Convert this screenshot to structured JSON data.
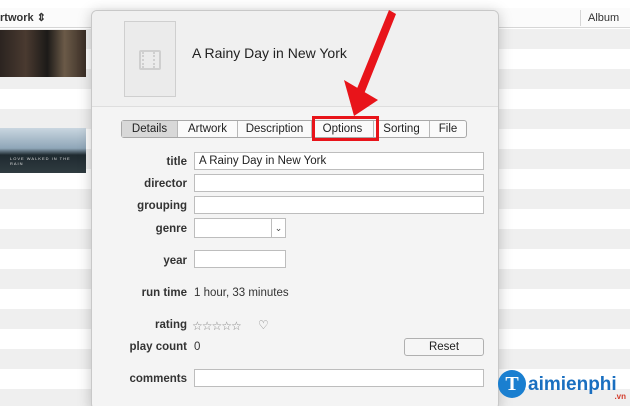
{
  "background_list": {
    "artwork_header": "rtwork",
    "sort_icon": "sort-updown-icon",
    "album_header": "Album",
    "thumb2_caption": "LOVE WALKED IN THE RAIN"
  },
  "dialog": {
    "title": "A Rainy Day in New York",
    "artwork_icon": "film-placeholder-icon",
    "tabs": [
      {
        "label": "Details",
        "active": true
      },
      {
        "label": "Artwork",
        "active": false
      },
      {
        "label": "Description",
        "active": false
      },
      {
        "label": "Options",
        "active": false
      },
      {
        "label": "Sorting",
        "active": false
      },
      {
        "label": "File",
        "active": false
      }
    ],
    "fields": {
      "title_label": "title",
      "title_value": "A Rainy Day in New York",
      "director_label": "director",
      "director_value": "",
      "grouping_label": "grouping",
      "grouping_value": "",
      "genre_label": "genre",
      "genre_value": "",
      "year_label": "year",
      "year_value": "",
      "run_time_label": "run time",
      "run_time_value": "1 hour, 33 minutes",
      "rating_label": "rating",
      "rating_stars": "☆☆☆☆☆",
      "rating_value": 0,
      "play_count_label": "play count",
      "play_count_value": "0",
      "reset_label": "Reset",
      "comments_label": "comments",
      "comments_value": ""
    }
  },
  "annotation": {
    "color": "#e8141a",
    "highlighted_tab": "Options"
  },
  "watermark": {
    "logo_letter": "T",
    "text": "aimienphi",
    "suffix": ".vn"
  }
}
